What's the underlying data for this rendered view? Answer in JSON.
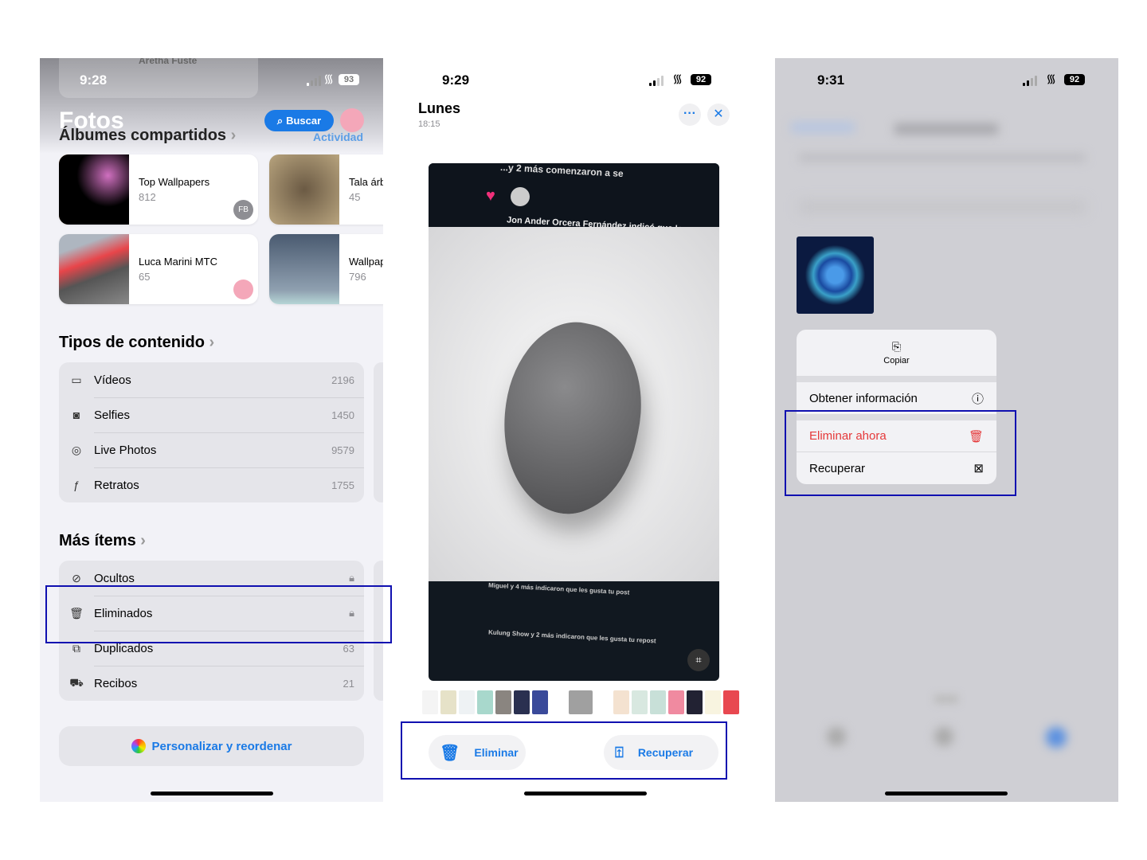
{
  "screen1": {
    "status": {
      "time": "9:28",
      "battery": "93"
    },
    "title": "Fotos",
    "search_label": "Buscar",
    "shared_header": "Álbumes compartidos",
    "activity_label": "Actividad",
    "top_blur_text": "Aretha Fuste",
    "albums": [
      {
        "title": "Top Wallpapers",
        "count": "812",
        "badge": "FB"
      },
      {
        "title": "Tala árb",
        "count": "45"
      },
      {
        "title": "Luca Marini MTC",
        "count": "65"
      },
      {
        "title": "Wallpap",
        "count": "796"
      }
    ],
    "content_types": {
      "header": "Tipos de contenido",
      "items": [
        {
          "icon": "video-icon",
          "label": "Vídeos",
          "count": "2196"
        },
        {
          "icon": "selfie-icon",
          "label": "Selfies",
          "count": "1450"
        },
        {
          "icon": "live-photo-icon",
          "label": "Live Photos",
          "count": "9579"
        },
        {
          "icon": "portrait-icon",
          "label": "Retratos",
          "count": "1755"
        }
      ]
    },
    "more_items": {
      "header": "Más ítems",
      "items": [
        {
          "icon": "eye-slash-icon",
          "label": "Ocultos",
          "value": "lock"
        },
        {
          "icon": "trash-icon",
          "label": "Eliminados",
          "value": "lock"
        },
        {
          "icon": "duplicate-icon",
          "label": "Duplicados",
          "count": "63"
        },
        {
          "icon": "cart-icon",
          "label": "Recibos",
          "count": "21"
        }
      ]
    },
    "customize_label": "Personalizar y reordenar"
  },
  "screen2": {
    "status": {
      "time": "9:29",
      "battery": "92"
    },
    "title": "Lunes",
    "subtitle": "18:15",
    "photo_text": {
      "line1": "...y 2 más comenzaron a se",
      "line2": "Jon Ander Orcera Fernández indicó que le gusta",
      "line3": "Miguel y 4 más indicaron que les gusta tu post",
      "line4": "Kulung Show y 2 más indicaron que les gusta tu repost"
    },
    "delete_label": "Eliminar",
    "recover_label": "Recuperar"
  },
  "screen3": {
    "status": {
      "time": "9:31",
      "battery": "92"
    },
    "copy_label": "Copiar",
    "info_label": "Obtener información",
    "delete_now_label": "Eliminar ahora",
    "recover_label": "Recuperar"
  },
  "colors": {
    "accent": "#1a7ae6",
    "destructive": "#e5393a",
    "highlight": "#1010b0"
  }
}
